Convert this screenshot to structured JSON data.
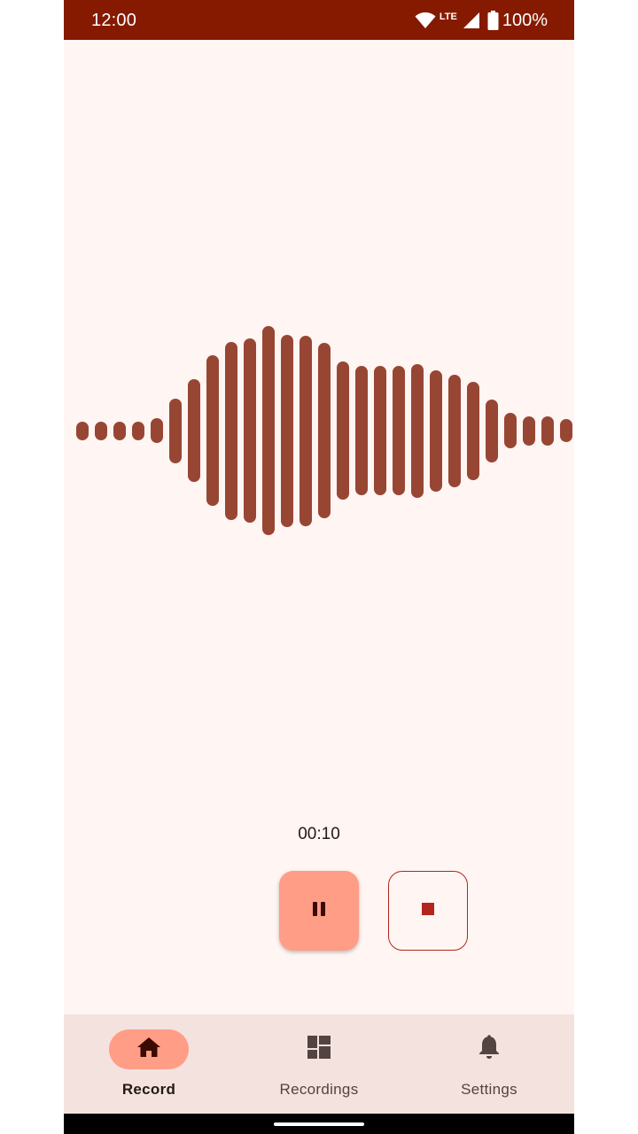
{
  "status_bar": {
    "time": "12:00",
    "network": "LTE",
    "battery": "100%",
    "icons": [
      "wifi-icon",
      "lte-icon",
      "cell-signal-icon",
      "battery-icon"
    ]
  },
  "waveform": {
    "color": "#984634",
    "levels": [
      0.09,
      0.09,
      0.09,
      0.09,
      0.12,
      0.31,
      0.49,
      0.72,
      0.85,
      0.88,
      1.0,
      0.92,
      0.91,
      0.84,
      0.66,
      0.62,
      0.62,
      0.62,
      0.64,
      0.58,
      0.54,
      0.47,
      0.3,
      0.17,
      0.14,
      0.14,
      0.11
    ]
  },
  "recorder": {
    "timer": "00:10",
    "pause_icon": "pause-icon",
    "stop_icon": "stop-icon"
  },
  "bottom_nav": {
    "items": [
      {
        "label": "Record",
        "icon": "home-icon",
        "active": true
      },
      {
        "label": "Recordings",
        "icon": "dashboard-icon",
        "active": false
      },
      {
        "label": "Settings",
        "icon": "bell-icon",
        "active": false
      }
    ]
  },
  "colors": {
    "status_bar": "#861a00",
    "background": "#fff5f3",
    "accent": "#ff9d87",
    "stop": "#b3261e",
    "nav_background": "#f4e2de"
  }
}
